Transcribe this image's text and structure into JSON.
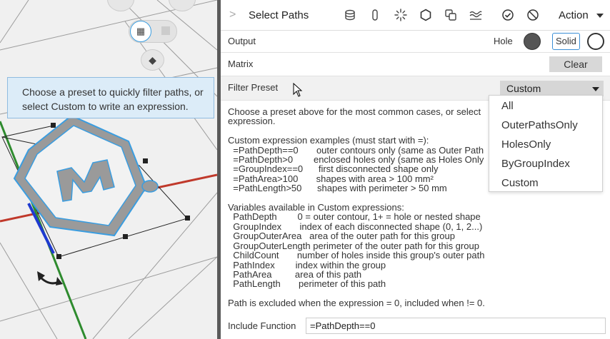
{
  "viewport": {
    "tooltip": "Choose a preset to quickly filter paths, or select Custom to write an expression.",
    "colors": {
      "background": "#f0f0f0",
      "shape_fill": "#9a9a9a",
      "selection": "#3a9de0",
      "axis_red": "#c0392b",
      "axis_green": "#2e8b2e",
      "axis_blue": "#1e3ad0"
    },
    "icons": [
      "grid-snap-icon",
      "square-icon",
      "box-icon",
      "rotate-arrow-icon"
    ]
  },
  "header": {
    "title": "Select Paths",
    "action_label": "Action",
    "icons": [
      "cylinder-icon",
      "capsule-icon",
      "sparkle-icon",
      "hexagon-icon",
      "duplicate-icon",
      "waves-icon",
      "check-circle-icon",
      "no-entry-icon"
    ]
  },
  "output": {
    "label": "Output",
    "hole_label": "Hole",
    "solid_label": "Solid"
  },
  "matrix": {
    "label": "Matrix",
    "clear_label": "Clear"
  },
  "filter": {
    "label": "Filter Preset",
    "selected": "Custom",
    "options": [
      "All",
      "OuterPathsOnly",
      "HolesOnly",
      "ByGroupIndex",
      "Custom"
    ]
  },
  "help": {
    "intro": "Choose a preset above for the most common cases, or select\nexpression.",
    "examples_title": "Custom expression examples (must start with =):",
    "examples": [
      "  =PathDepth==0       outer contours only (same as Outer Path",
      "  =PathDepth>0        enclosed holes only (same as Holes Only",
      "  =GroupIndex==0      first disconnected shape only",
      "  =PathArea>100       shapes with area > 100 mm²",
      "  =PathLength>50      shapes with perimeter > 50 mm"
    ],
    "variables_title": "Variables available in Custom expressions:",
    "variables": [
      "  PathDepth        0 = outer contour, 1+ = hole or nested shape",
      "  GroupIndex       index of each disconnected shape (0, 1, 2...)",
      "  GroupOuterArea   area of the outer path for this group",
      "  GroupOuterLength perimeter of the outer path for this group",
      "  ChildCount       number of holes inside this group's outer path",
      "  PathIndex        index within the group",
      "  PathArea         area of this path",
      "  PathLength       perimeter of this path"
    ],
    "note": "Path is excluded when the expression = 0, included when != 0."
  },
  "include": {
    "label": "Include Function",
    "value": "=PathDepth==0"
  }
}
